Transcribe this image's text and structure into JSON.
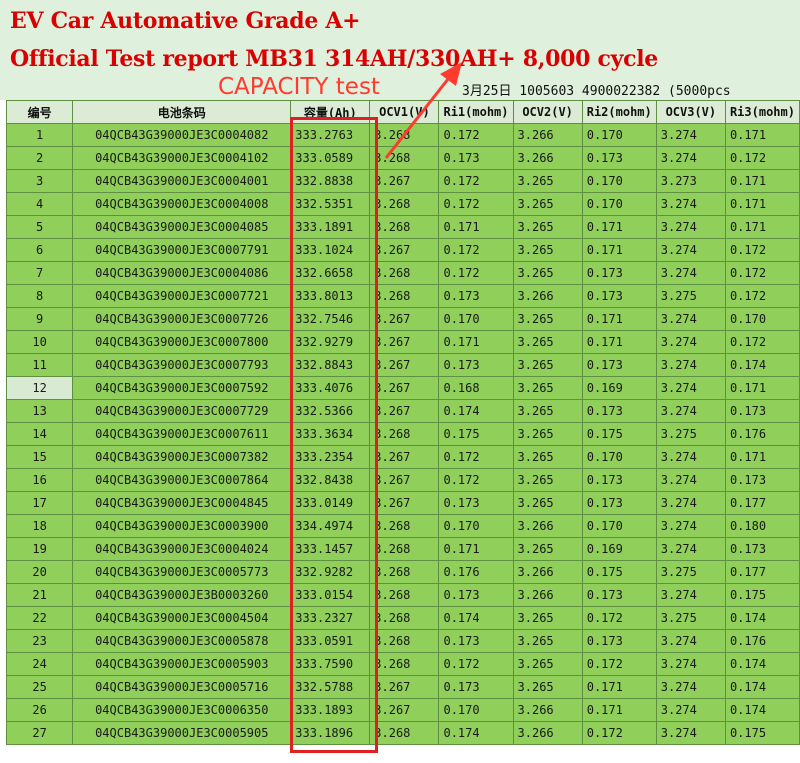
{
  "title_line1": "EV Car Automative Grade A+",
  "title_line2": "Official Test report MB31 314AH/330AH+ 8,000 cycle",
  "capacity_label": "CAPACITY test",
  "date_line": "3月25日  1005603  4900022382 (5000pcs",
  "headers": [
    "编号",
    "电池条码",
    "容量(Ah)",
    "OCV1(V)",
    "Ri1(mohm)",
    "OCV2(V)",
    "Ri2(mohm)",
    "OCV3(V)",
    "Ri3(mohm)"
  ],
  "rows": [
    [
      "1",
      "04QCB43G39000JE3C0004082",
      "333.2763",
      "3.268",
      "0.172",
      "3.266",
      "0.170",
      "3.274",
      "0.171"
    ],
    [
      "2",
      "04QCB43G39000JE3C0004102",
      "333.0589",
      "3.268",
      "0.173",
      "3.266",
      "0.173",
      "3.274",
      "0.172"
    ],
    [
      "3",
      "04QCB43G39000JE3C0004001",
      "332.8838",
      "3.267",
      "0.172",
      "3.265",
      "0.170",
      "3.273",
      "0.171"
    ],
    [
      "4",
      "04QCB43G39000JE3C0004008",
      "332.5351",
      "3.268",
      "0.172",
      "3.265",
      "0.170",
      "3.274",
      "0.171"
    ],
    [
      "5",
      "04QCB43G39000JE3C0004085",
      "333.1891",
      "3.268",
      "0.171",
      "3.265",
      "0.171",
      "3.274",
      "0.171"
    ],
    [
      "6",
      "04QCB43G39000JE3C0007791",
      "333.1024",
      "3.267",
      "0.172",
      "3.265",
      "0.171",
      "3.274",
      "0.172"
    ],
    [
      "7",
      "04QCB43G39000JE3C0004086",
      "332.6658",
      "3.268",
      "0.172",
      "3.265",
      "0.173",
      "3.274",
      "0.172"
    ],
    [
      "8",
      "04QCB43G39000JE3C0007721",
      "333.8013",
      "3.268",
      "0.173",
      "3.266",
      "0.173",
      "3.275",
      "0.172"
    ],
    [
      "9",
      "04QCB43G39000JE3C0007726",
      "332.7546",
      "3.267",
      "0.170",
      "3.265",
      "0.171",
      "3.274",
      "0.170"
    ],
    [
      "10",
      "04QCB43G39000JE3C0007800",
      "332.9279",
      "3.267",
      "0.171",
      "3.265",
      "0.171",
      "3.274",
      "0.172"
    ],
    [
      "11",
      "04QCB43G39000JE3C0007793",
      "332.8843",
      "3.267",
      "0.173",
      "3.265",
      "0.173",
      "3.274",
      "0.174"
    ],
    [
      "12",
      "04QCB43G39000JE3C0007592",
      "333.4076",
      "3.267",
      "0.168",
      "3.265",
      "0.169",
      "3.274",
      "0.171"
    ],
    [
      "13",
      "04QCB43G39000JE3C0007729",
      "332.5366",
      "3.267",
      "0.174",
      "3.265",
      "0.173",
      "3.274",
      "0.173"
    ],
    [
      "14",
      "04QCB43G39000JE3C0007611",
      "333.3634",
      "3.268",
      "0.175",
      "3.265",
      "0.175",
      "3.275",
      "0.176"
    ],
    [
      "15",
      "04QCB43G39000JE3C0007382",
      "333.2354",
      "3.267",
      "0.172",
      "3.265",
      "0.170",
      "3.274",
      "0.171"
    ],
    [
      "16",
      "04QCB43G39000JE3C0007864",
      "332.8438",
      "3.267",
      "0.172",
      "3.265",
      "0.173",
      "3.274",
      "0.173"
    ],
    [
      "17",
      "04QCB43G39000JE3C0004845",
      "333.0149",
      "3.267",
      "0.173",
      "3.265",
      "0.173",
      "3.274",
      "0.177"
    ],
    [
      "18",
      "04QCB43G39000JE3C0003900",
      "334.4974",
      "3.268",
      "0.170",
      "3.266",
      "0.170",
      "3.274",
      "0.180"
    ],
    [
      "19",
      "04QCB43G39000JE3C0004024",
      "333.1457",
      "3.268",
      "0.171",
      "3.265",
      "0.169",
      "3.274",
      "0.173"
    ],
    [
      "20",
      "04QCB43G39000JE3C0005773",
      "332.9282",
      "3.268",
      "0.176",
      "3.266",
      "0.175",
      "3.275",
      "0.177"
    ],
    [
      "21",
      "04QCB43G39000JE3B0003260",
      "333.0154",
      "3.268",
      "0.173",
      "3.266",
      "0.173",
      "3.274",
      "0.175"
    ],
    [
      "22",
      "04QCB43G39000JE3C0004504",
      "333.2327",
      "3.268",
      "0.174",
      "3.265",
      "0.172",
      "3.275",
      "0.174"
    ],
    [
      "23",
      "04QCB43G39000JE3C0005878",
      "333.0591",
      "3.268",
      "0.173",
      "3.265",
      "0.173",
      "3.274",
      "0.176"
    ],
    [
      "24",
      "04QCB43G39000JE3C0005903",
      "333.7590",
      "3.268",
      "0.172",
      "3.265",
      "0.172",
      "3.274",
      "0.174"
    ],
    [
      "25",
      "04QCB43G39000JE3C0005716",
      "332.5788",
      "3.267",
      "0.173",
      "3.265",
      "0.171",
      "3.274",
      "0.174"
    ],
    [
      "26",
      "04QCB43G39000JE3C0006350",
      "333.1893",
      "3.267",
      "0.170",
      "3.266",
      "0.171",
      "3.274",
      "0.174"
    ],
    [
      "27",
      "04QCB43G39000JE3C0005905",
      "333.1896",
      "3.268",
      "0.174",
      "3.266",
      "0.172",
      "3.274",
      "0.175"
    ]
  ],
  "colors": {
    "cell_fill": "#8fcf5a",
    "header_fill": "#dcebd5",
    "title_red": "#d80000",
    "annotation_red": "#e02020"
  },
  "selected_row": "12"
}
